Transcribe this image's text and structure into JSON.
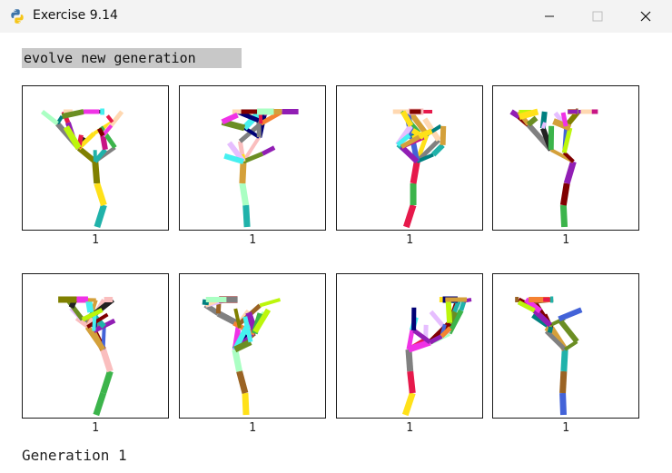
{
  "window": {
    "title": "Exercise 9.14",
    "icon": "python-icon",
    "controls": [
      "minimize-icon",
      "maximize-icon",
      "close-icon"
    ]
  },
  "toolbar": {
    "evolve_label": "evolve new generation"
  },
  "grid": {
    "cells": [
      {
        "fitness": "1"
      },
      {
        "fitness": "1"
      },
      {
        "fitness": "1"
      },
      {
        "fitness": "1"
      },
      {
        "fitness": "1"
      },
      {
        "fitness": "1"
      },
      {
        "fitness": "1"
      },
      {
        "fitness": "1"
      }
    ]
  },
  "status": {
    "generation_label": "Generation 1"
  },
  "colors": {
    "titlebar": "#f3f3f3",
    "button_bg": "#c8c8c8",
    "cell_border": "#1a1a1a"
  }
}
